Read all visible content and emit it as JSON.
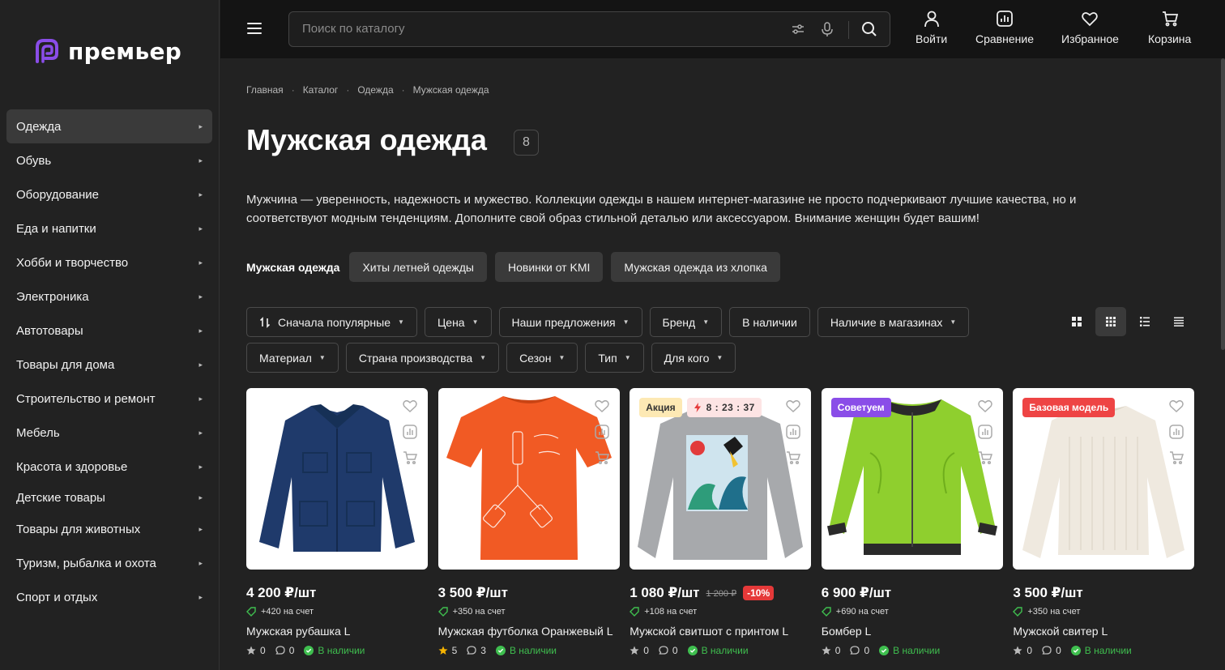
{
  "logo": {
    "text": "премьер",
    "accent": "#8a4de8"
  },
  "sidebar": {
    "items": [
      {
        "label": "Одежда",
        "active": true
      },
      {
        "label": "Обувь"
      },
      {
        "label": "Оборудование"
      },
      {
        "label": "Еда и напитки"
      },
      {
        "label": "Хобби и творчество"
      },
      {
        "label": "Электроника"
      },
      {
        "label": "Автотовары"
      },
      {
        "label": "Товары для дома"
      },
      {
        "label": "Строительство и ремонт"
      },
      {
        "label": "Мебель"
      },
      {
        "label": "Красота и здоровье"
      },
      {
        "label": "Детские товары"
      },
      {
        "label": "Товары для животных"
      },
      {
        "label": "Туризм, рыбалка и охота"
      },
      {
        "label": "Спорт и отдых"
      }
    ]
  },
  "header": {
    "search_placeholder": "Поиск по каталогу",
    "login": "Войти",
    "compare": "Сравнение",
    "favorites": "Избранное",
    "cart": "Корзина"
  },
  "breadcrumbs": [
    "Главная",
    "Каталог",
    "Одежда",
    "Мужская одежда"
  ],
  "page": {
    "title": "Мужская одежда",
    "count": "8",
    "description": "Мужчина — уверенность, надежность и мужество. Коллекции одежды в нашем интернет-магазине не просто подчеркивают лучшие качества, но и соответствуют модным тенденциям. Дополните свой образ стильной деталью или аксессуаром. Внимание женщин будет вашим!"
  },
  "tags": {
    "current": "Мужская одежда",
    "items": [
      "Хиты летней одежды",
      "Новинки от KMI",
      "Мужская одежда из хлопка"
    ]
  },
  "filters": {
    "row1": [
      "Сначала популярные",
      "Цена",
      "Наши предложения",
      "Бренд",
      "В наличии",
      "Наличие в магазинах"
    ],
    "row2": [
      "Материал",
      "Страна производства",
      "Сезон",
      "Тип",
      "Для кого"
    ]
  },
  "products": [
    {
      "price": "4 200 ₽/шт",
      "bonus": "+420 на счет",
      "name": "Мужская рубашка L",
      "rating": "0",
      "reviews": "0",
      "stock": "В наличии"
    },
    {
      "price": "3 500 ₽/шт",
      "bonus": "+350 на счет",
      "name": "Мужская футболка Оранжевый L",
      "rating": "5",
      "reviews": "3",
      "stock": "В наличии"
    },
    {
      "price": "1 080 ₽/шт",
      "old_price": "1 200 ₽",
      "discount": "-10%",
      "bonus": "+108 на счет",
      "name": "Мужской свитшот с принтом L",
      "rating": "0",
      "reviews": "0",
      "stock": "В наличии",
      "badge": "Акция",
      "timer": "8 : 23 : 37"
    },
    {
      "price": "6 900 ₽/шт",
      "bonus": "+690 на счет",
      "name": "Бомбер L",
      "rating": "0",
      "reviews": "0",
      "stock": "В наличии",
      "badge": "Советуем"
    },
    {
      "price": "3 500 ₽/шт",
      "bonus": "+350 на счет",
      "name": "Мужской свитер L",
      "rating": "0",
      "reviews": "0",
      "stock": "В наличии",
      "badge": "Базовая модель"
    }
  ]
}
